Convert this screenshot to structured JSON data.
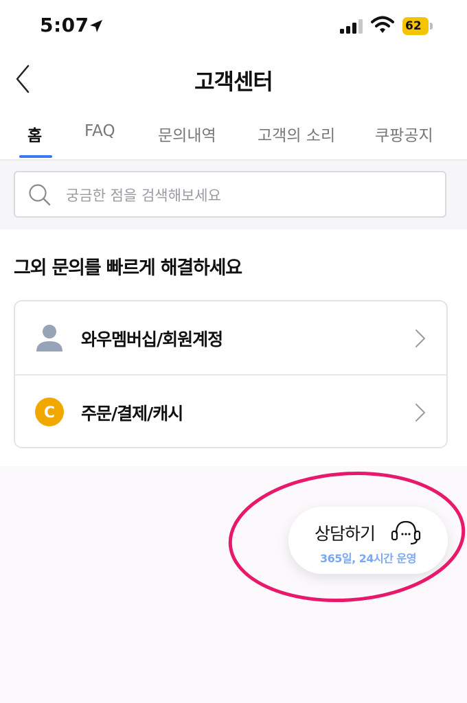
{
  "status_bar": {
    "time": "5:07",
    "battery_level": "62",
    "icons": [
      "location-arrow-icon",
      "signal-icon",
      "wifi-icon",
      "battery-icon"
    ]
  },
  "header": {
    "title": "고객센터",
    "back_icon": "chevron-left-icon"
  },
  "tabs": [
    {
      "label": "홈",
      "active": true
    },
    {
      "label": "FAQ",
      "active": false
    },
    {
      "label": "문의내역",
      "active": false
    },
    {
      "label": "고객의 소리",
      "active": false
    },
    {
      "label": "쿠팡공지",
      "active": false
    }
  ],
  "search": {
    "placeholder": "궁금한 점을 검색해보세요",
    "value": ""
  },
  "quick": {
    "title": "그외 문의를 빠르게 해결하세요",
    "items": [
      {
        "label": "와우멤버십/회원계정",
        "icon": "person-icon"
      },
      {
        "label": "주문/결제/캐시",
        "icon": "coupang-cash-icon",
        "icon_text": "C"
      }
    ]
  },
  "consult": {
    "label": "상담하기",
    "sub": "365일, 24시간 운영",
    "icon": "headset-icon"
  },
  "colors": {
    "accent": "#3a7cf0",
    "cash_icon": "#f0a800",
    "sub_text": "#7aa7f7",
    "annotation": "#e8196b"
  }
}
